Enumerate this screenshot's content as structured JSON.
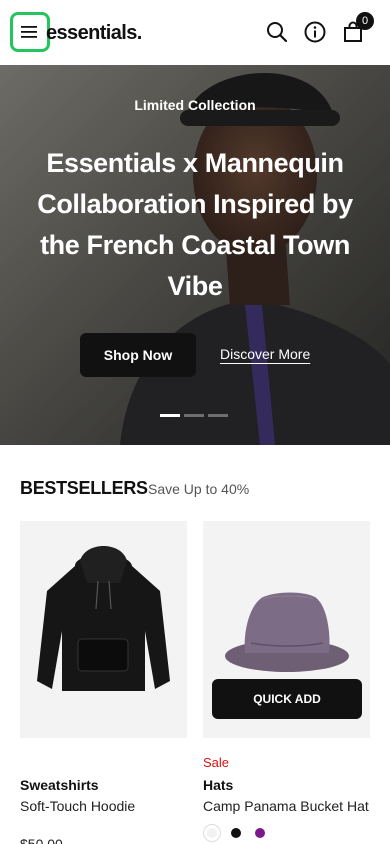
{
  "header": {
    "logo": "essentials.",
    "cart_count": "0",
    "icons": [
      "menu-icon",
      "search-icon",
      "info-icon",
      "bag-icon"
    ]
  },
  "hero": {
    "eyebrow": "Limited Collection",
    "title": "Essentials x Mannequin Collaboration Inspired by the French Coastal Town Vibe",
    "primary_cta": "Shop Now",
    "secondary_cta": "Discover More",
    "slides_count": 3,
    "active_slide": 1
  },
  "bestsellers": {
    "title": "BESTSELLERS",
    "subtitle": "Save Up to 40%",
    "products": [
      {
        "category": "Sweatshirts",
        "name": "Soft-Touch Hoodie",
        "price": "$50.00",
        "sale": ""
      },
      {
        "category": "Hats",
        "name": "Camp Panama Bucket Hat",
        "sale": "Sale",
        "quick_add": "QUICK ADD",
        "swatches": [
          "#f2f2f2",
          "#111111",
          "#7a1a8a"
        ]
      }
    ]
  },
  "colors": {
    "accent_outline": "#22c55e",
    "sale_red": "#dd1111",
    "button_dark": "#111111"
  }
}
